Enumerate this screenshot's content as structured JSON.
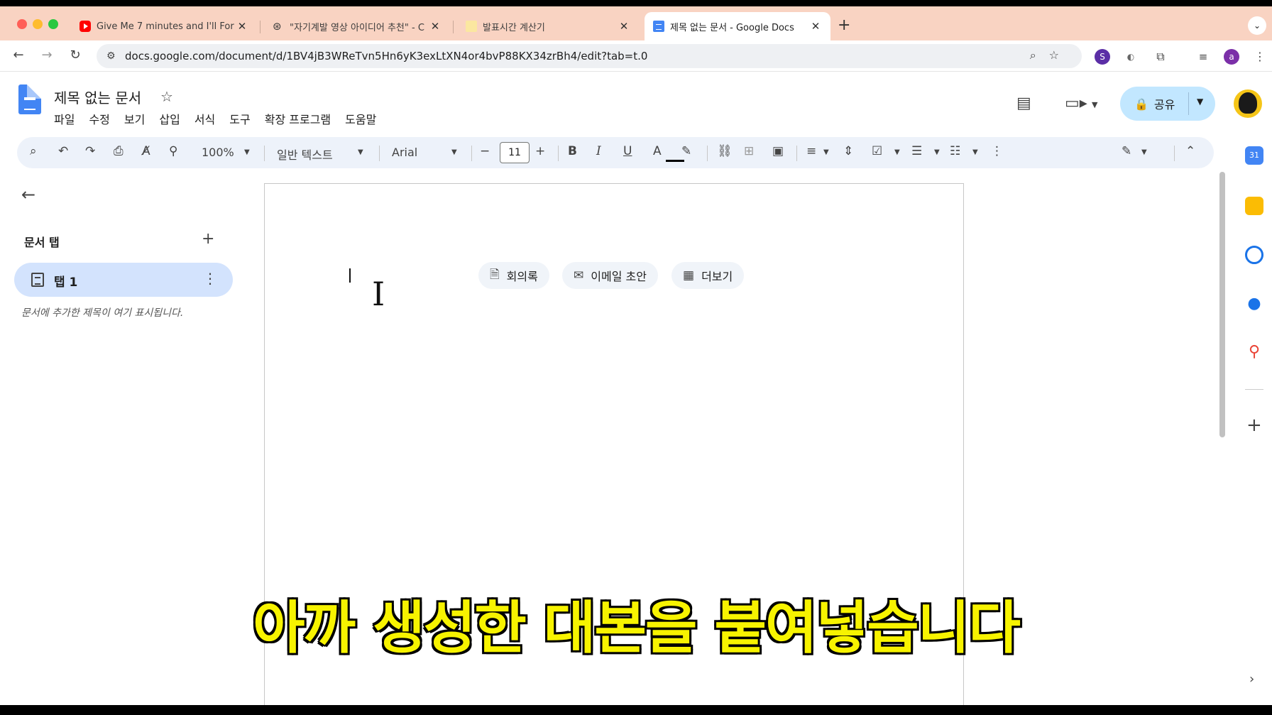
{
  "browser": {
    "tabs": [
      {
        "title": "Give Me 7 minutes and I'll For",
        "icon": "youtube-icon"
      },
      {
        "title": "\"자기계발 영상 아이디어 추천\" - C",
        "icon": "chatgpt-icon"
      },
      {
        "title": "발표시간 계산기",
        "icon": "note-icon"
      },
      {
        "title": "제목 없는 문서 - Google Docs",
        "icon": "docs-icon",
        "active": true
      }
    ],
    "url": "docs.google.com/document/d/1BV4jB3WReTvn5Hn6yK3exLtXN4or4bvP88KX34zrBh4/edit?tab=t.0"
  },
  "docs": {
    "title": "제목 없는 문서",
    "menu": [
      "파일",
      "수정",
      "보기",
      "삽입",
      "서식",
      "도구",
      "확장 프로그램",
      "도움말"
    ],
    "share_label": "공유"
  },
  "toolbar": {
    "zoom": "100%",
    "style": "일반 텍스트",
    "font": "Arial",
    "font_size": "11"
  },
  "left_panel": {
    "title": "문서 탭",
    "tab_label": "탭 1",
    "hint": "문서에 추가한 제목이 여기 표시됩니다."
  },
  "chips": [
    {
      "label": "회의록",
      "icon": "doc-icon"
    },
    {
      "label": "이메일 초안",
      "icon": "email-icon"
    },
    {
      "label": "더보기",
      "icon": "more-doc-icon"
    }
  ],
  "caption": "아까 생성한 대본을 붙여넣습니다",
  "colors": {
    "tab_strip": "#f9d3c2",
    "share_button": "#c2e7ff",
    "toolbar": "#edf2fa",
    "caption": "#f7f300"
  }
}
